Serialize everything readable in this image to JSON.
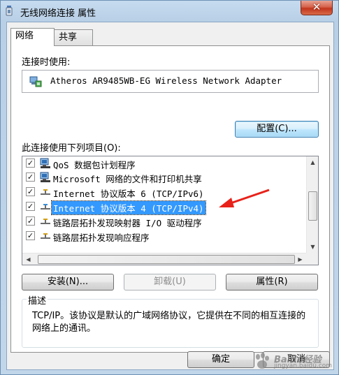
{
  "window": {
    "title": "无线网络连接 属性",
    "close_label": "✕"
  },
  "tabs": [
    {
      "label": "网络",
      "active": true
    },
    {
      "label": "共享",
      "active": false
    }
  ],
  "connect_using": {
    "label": "连接时使用:",
    "adapter": "Atheros AR9485WB-EG Wireless Network Adapter",
    "configure_label": "配置(C)..."
  },
  "items_section": {
    "label": "此连接使用下列项目(O):",
    "items": [
      {
        "label": "QoS 数据包计划程序",
        "checked": true,
        "icon": "network-client-icon",
        "selected": false
      },
      {
        "label": "Microsoft 网络的文件和打印机共享",
        "checked": true,
        "icon": "network-client-icon",
        "selected": false
      },
      {
        "label": "Internet 协议版本 6 (TCP/IPv6)",
        "checked": true,
        "icon": "network-protocol-icon",
        "selected": false
      },
      {
        "label": "Internet 协议版本 4 (TCP/IPv4)",
        "checked": true,
        "icon": "network-protocol-icon",
        "selected": true
      },
      {
        "label": "链路层拓扑发现映射器 I/O 驱动程序",
        "checked": true,
        "icon": "network-protocol-icon",
        "selected": false
      },
      {
        "label": "链路层拓扑发现响应程序",
        "checked": true,
        "icon": "network-protocol-icon",
        "selected": false
      }
    ]
  },
  "buttons": {
    "install": "安装(N)...",
    "uninstall": "卸载(U)",
    "properties": "属性(R)",
    "ok": "确定",
    "cancel": "取消"
  },
  "description": {
    "title": "描述",
    "text": "TCP/IP。该协议是默认的广域网络协议，它提供在不同的相互连接的网络上的通讯。"
  },
  "watermark": {
    "text": "Baidu经验",
    "sub": "jingyan.baidu.com"
  },
  "colors": {
    "selection": "#3399ff",
    "arrow": "#e8221a"
  }
}
